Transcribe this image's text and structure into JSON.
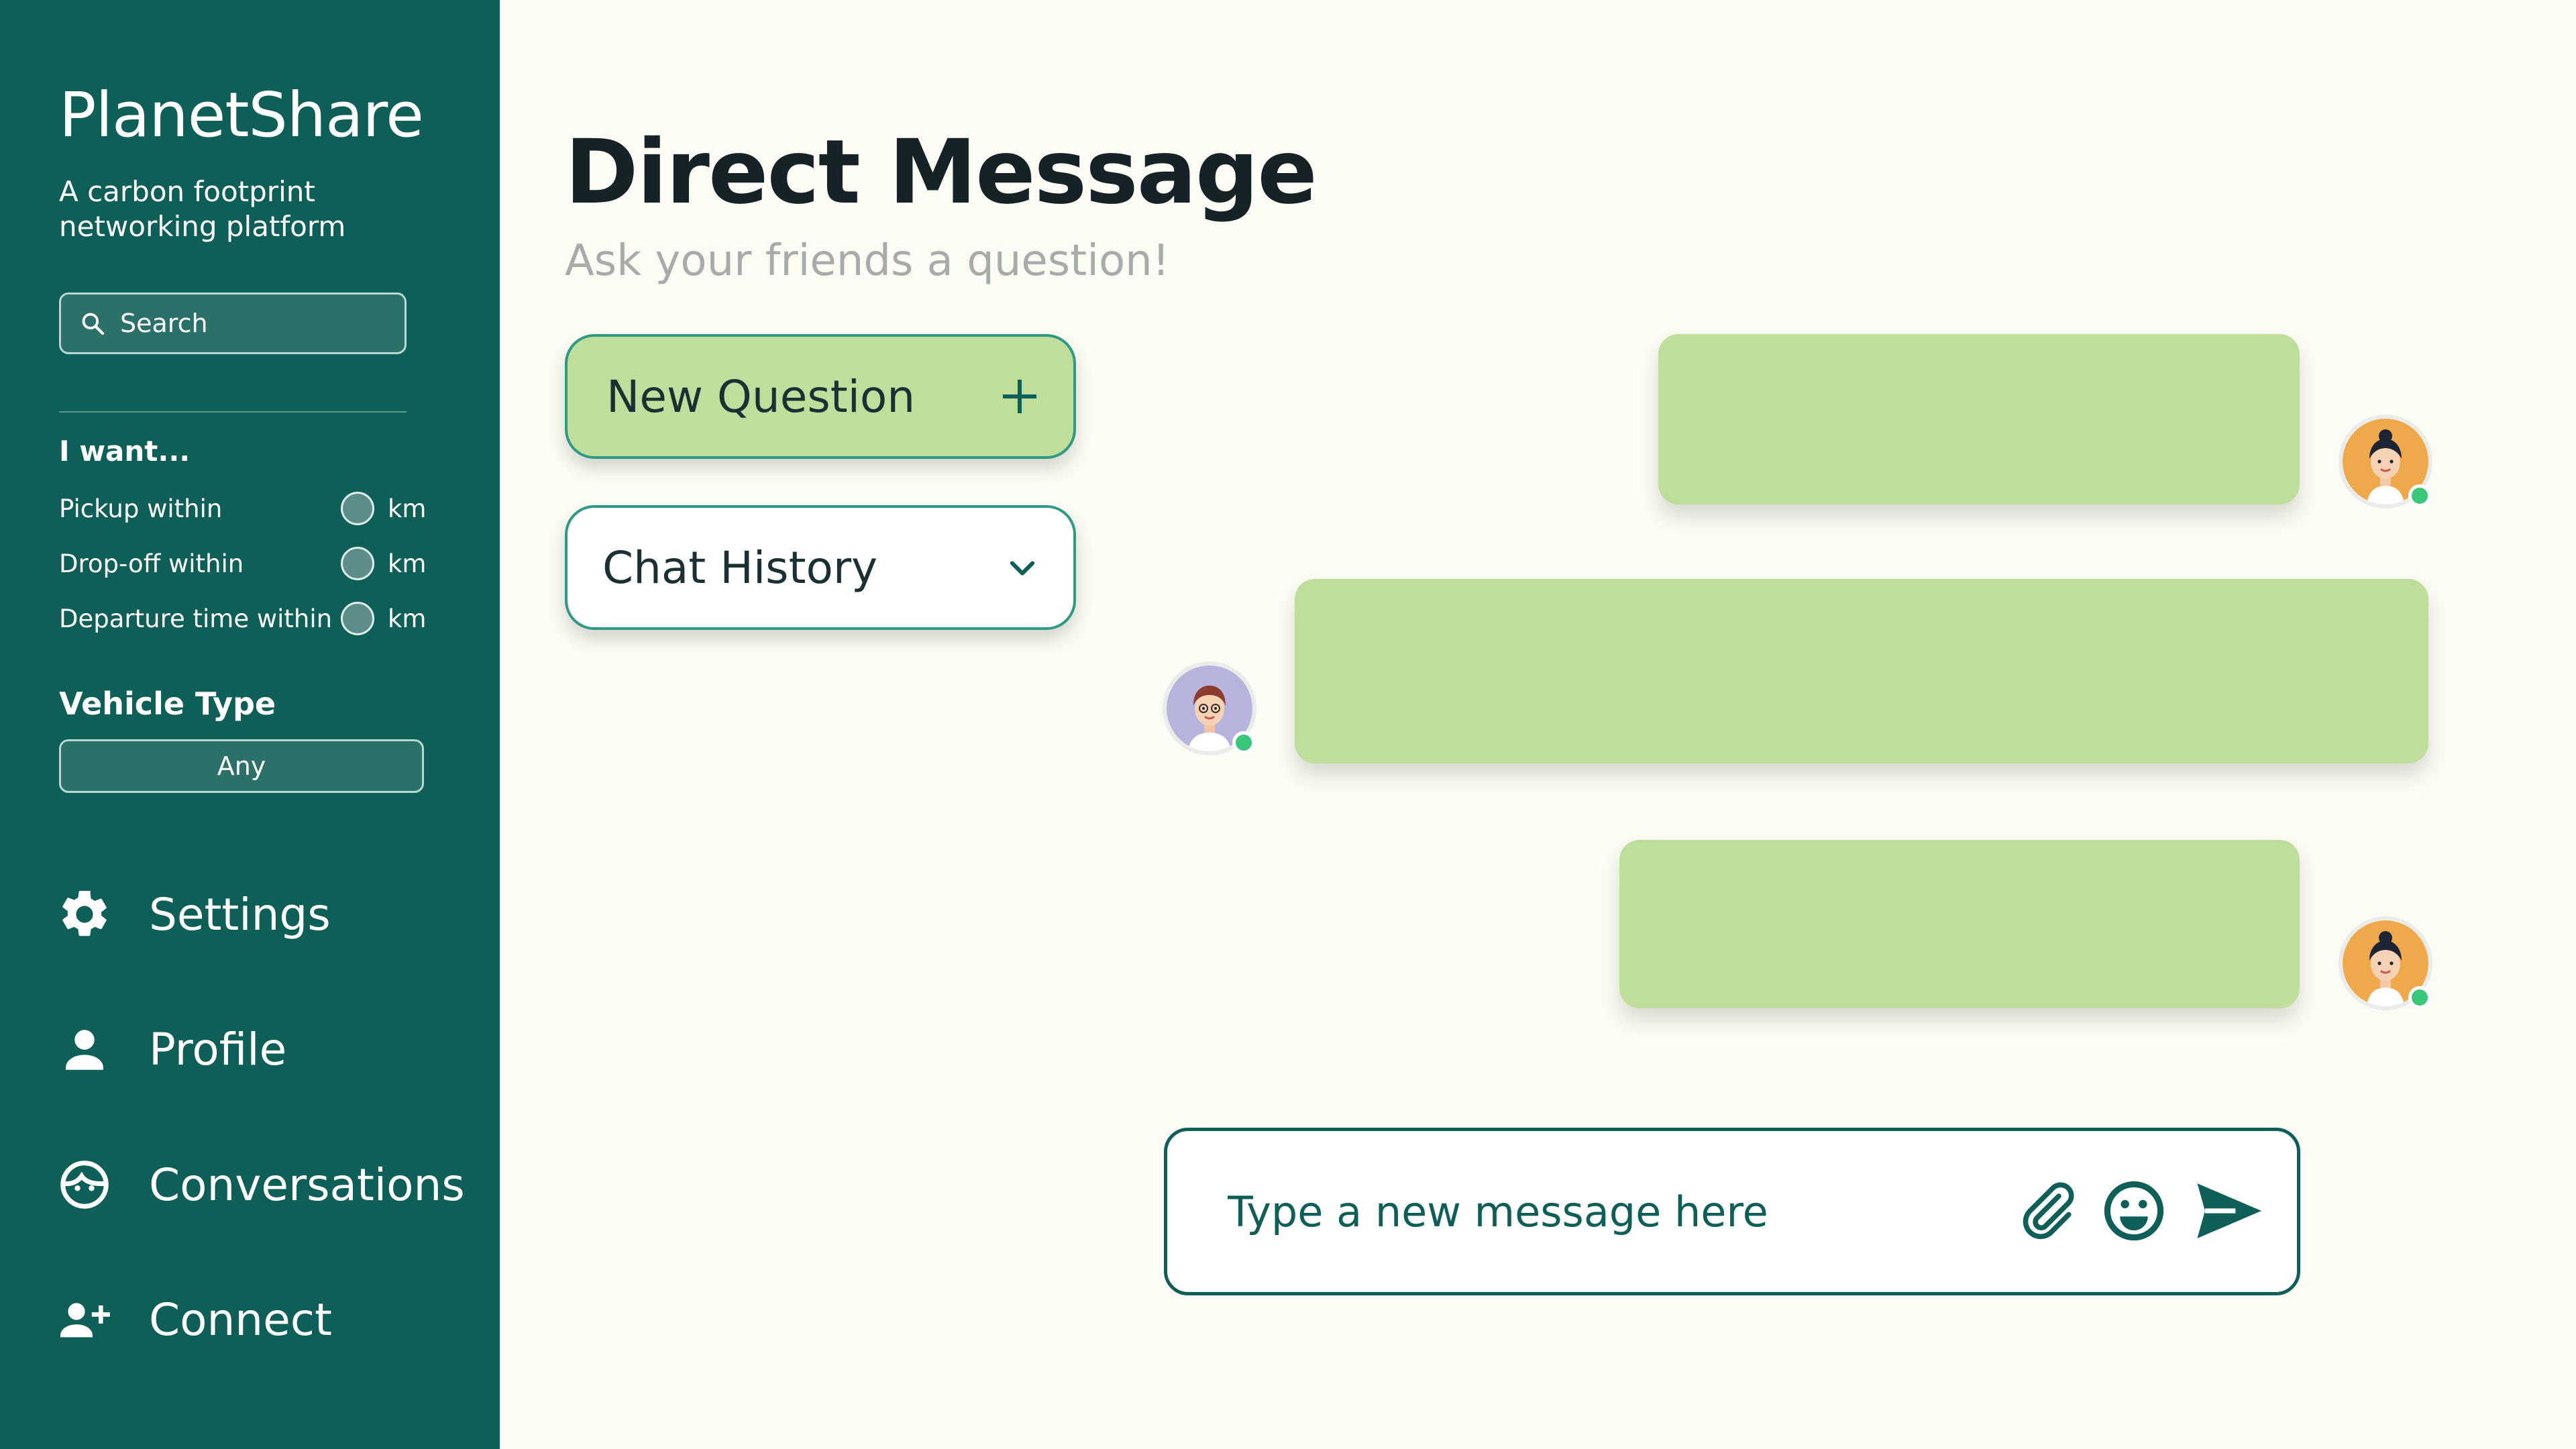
{
  "sidebar": {
    "brand": "PlanetShare",
    "tagline": "A carbon footprint networking platform",
    "search_placeholder": "Search",
    "filters_heading": "I want...",
    "filters": [
      {
        "label": "Pickup within",
        "unit": "km"
      },
      {
        "label": "Drop-off within",
        "unit": "km"
      },
      {
        "label": "Departure time within",
        "unit": "km"
      }
    ],
    "vehicle_heading": "Vehicle Type",
    "vehicle_value": "Any",
    "nav": [
      {
        "label": "Settings",
        "icon": "gear-icon"
      },
      {
        "label": "Profile",
        "icon": "person-icon"
      },
      {
        "label": "Conversations",
        "icon": "face-icon"
      },
      {
        "label": "Connect",
        "icon": "add-person-icon"
      }
    ]
  },
  "main": {
    "title": "Direct Message",
    "subtitle": "Ask your friends a question!",
    "new_question_label": "New Question",
    "chat_history_label": "Chat History",
    "composer_placeholder": "Type a new message here"
  },
  "colors": {
    "sidebar_bg": "#0e5f58",
    "page_bg": "#fbfdf4",
    "bubble": "#bfdd9b",
    "accent_border": "#2f9a83",
    "online": "#39c77a"
  }
}
